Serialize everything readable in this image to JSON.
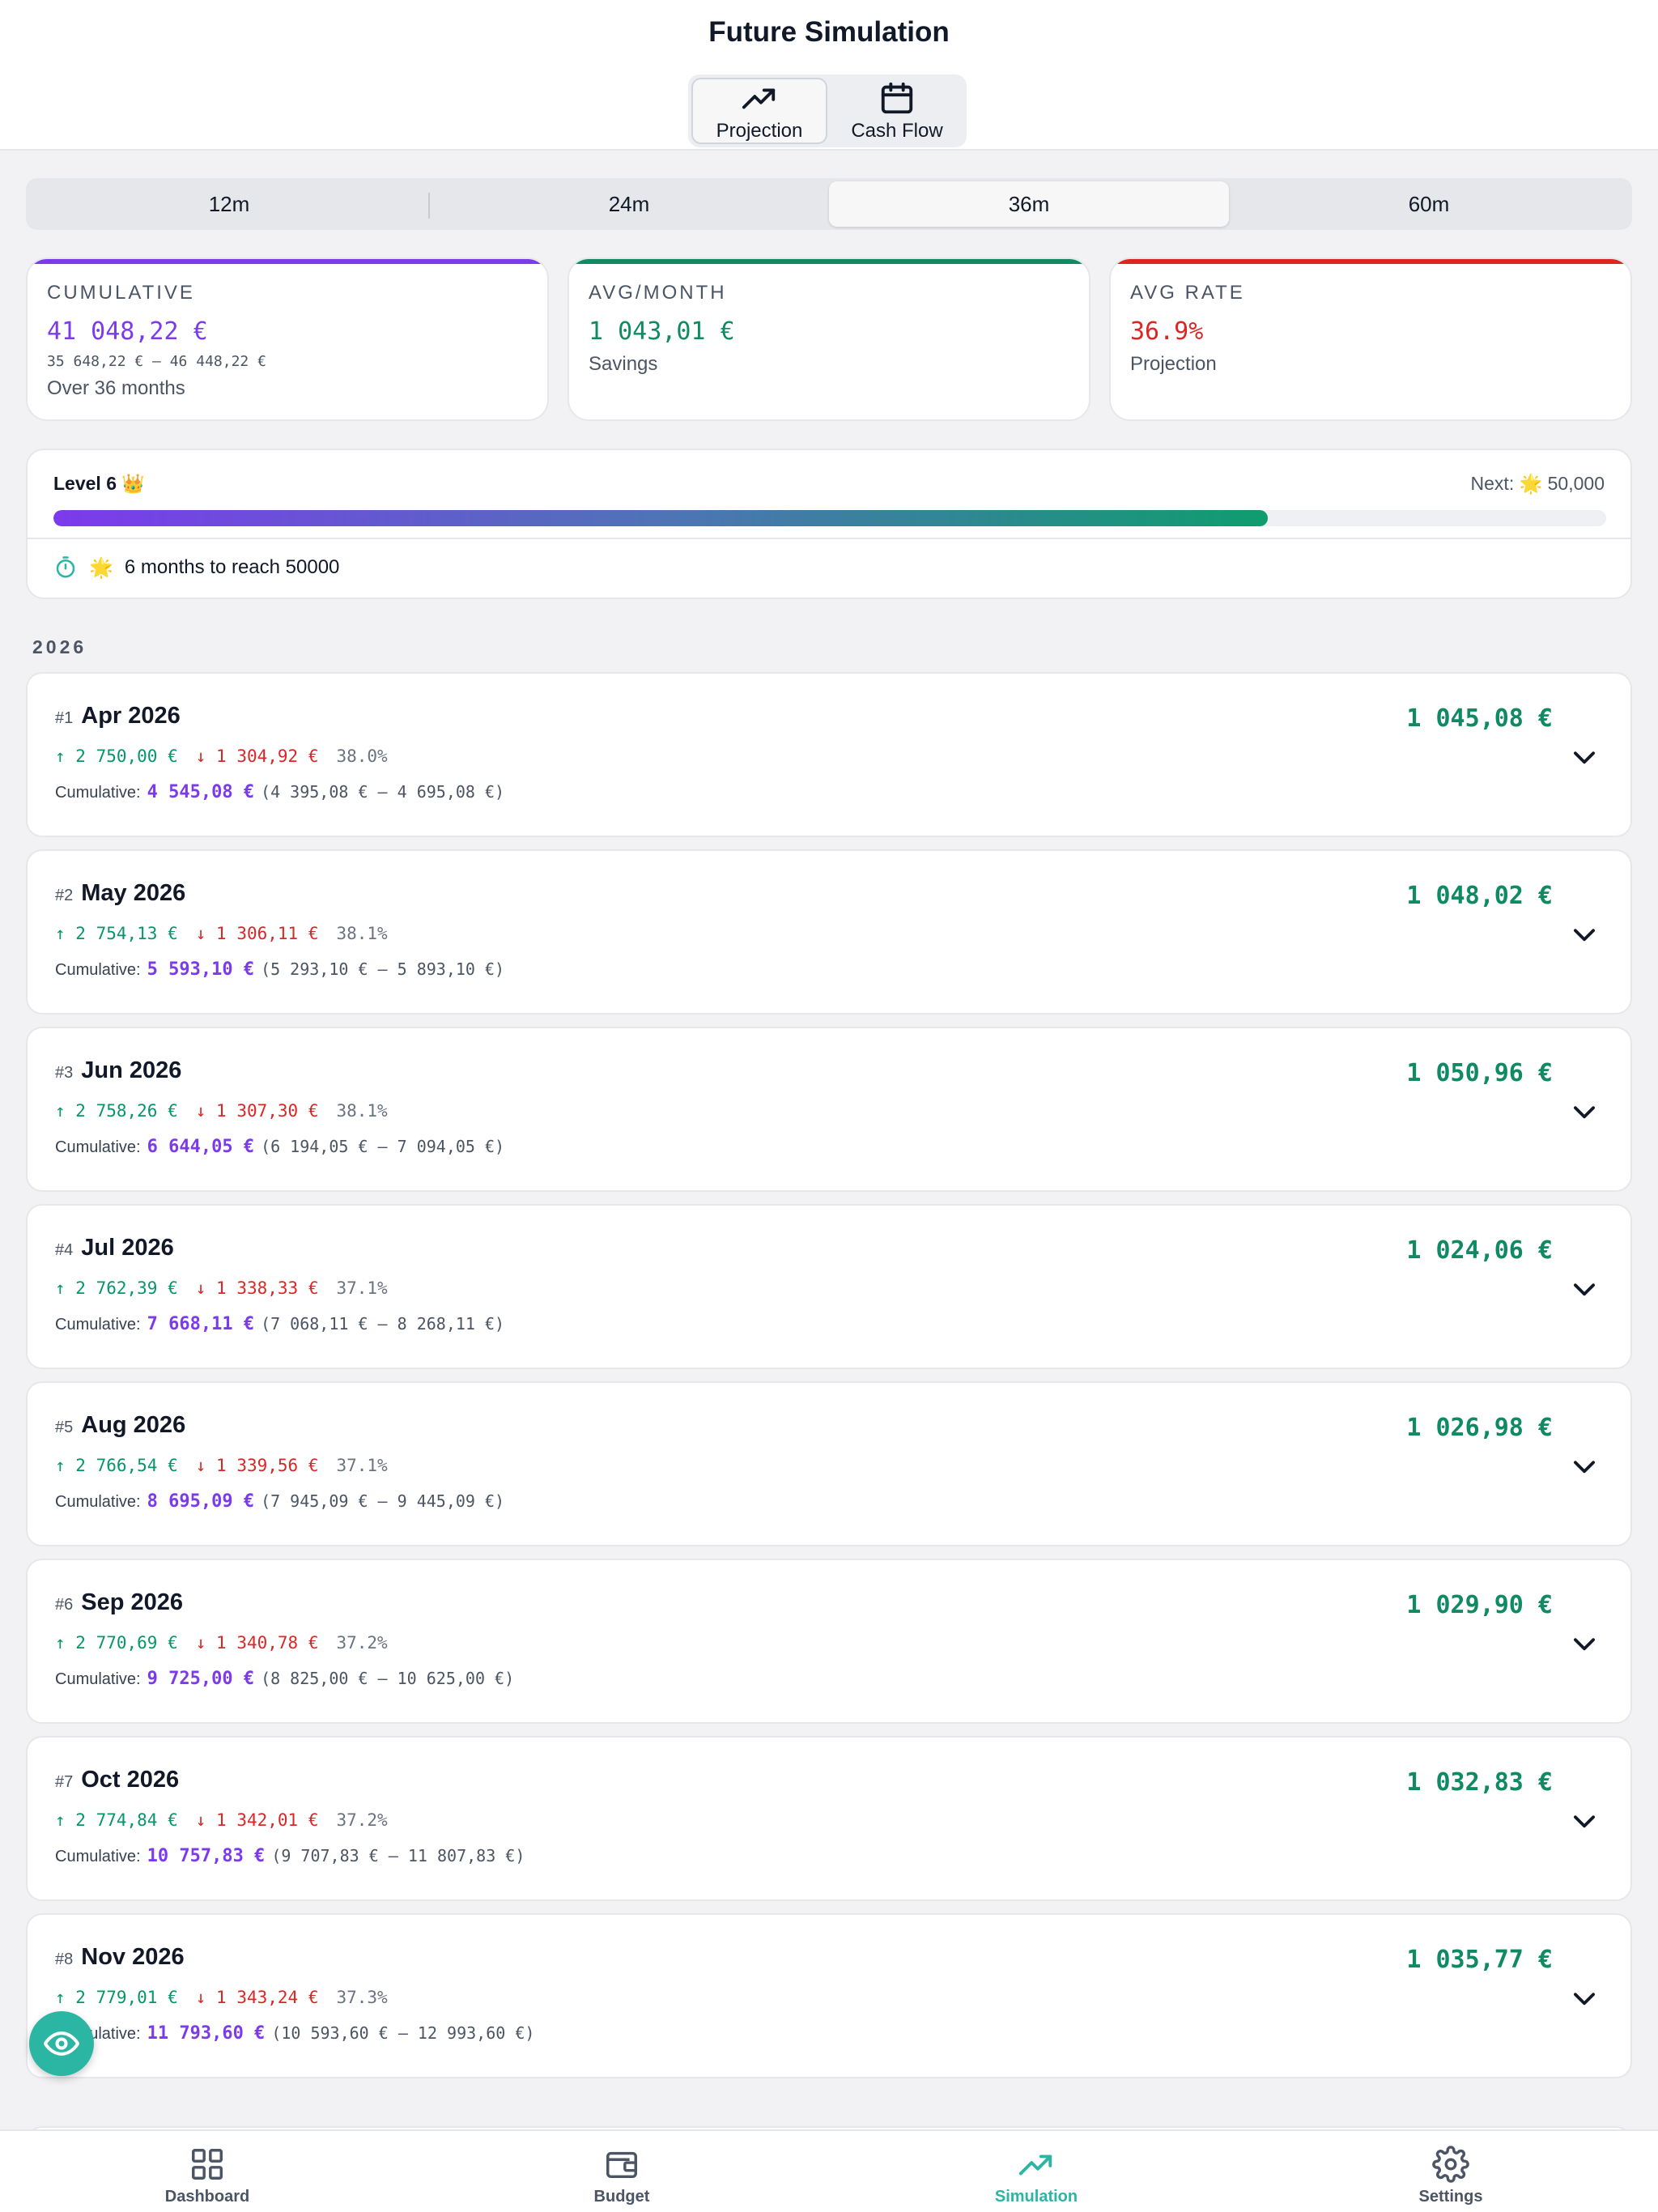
{
  "header": {
    "title": "Future Simulation",
    "modes": [
      {
        "label": "Projection",
        "icon": "trending-up-icon",
        "active": true
      },
      {
        "label": "Cash Flow",
        "icon": "calendar-icon",
        "active": false
      }
    ]
  },
  "periods": [
    {
      "label": "12m",
      "active": false
    },
    {
      "label": "24m",
      "active": false
    },
    {
      "label": "36m",
      "active": true
    },
    {
      "label": "60m",
      "active": false
    }
  ],
  "stats": {
    "cumulative": {
      "label": "CUMULATIVE",
      "value": "41 048,22 €",
      "range": "35 648,22 € – 46 448,22 €",
      "sub": "Over 36 months",
      "color": "#7c3aed"
    },
    "avg_month": {
      "label": "AVG/MONTH",
      "value": "1 043,01 €",
      "sub": "Savings",
      "color": "#0f8a63"
    },
    "avg_rate": {
      "label": "AVG RATE",
      "value": "36.9%",
      "sub": "Projection",
      "color": "#dc2626"
    }
  },
  "level": {
    "title": "Level 6 👑",
    "next_label": "Next:",
    "next_icon": "🌟",
    "next_value": "50,000",
    "progress": 0.782,
    "eta_icon": "🌟",
    "eta_text": "6 months to reach 50000"
  },
  "year": "2026",
  "months": [
    {
      "index": "#1",
      "name": "Apr 2026",
      "income": "2 750,00 €",
      "expense": "1 304,92 €",
      "rate": "38.0%",
      "cum_label": "Cumulative:",
      "cum": "4 545,08 €",
      "cum_range": "(4 395,08 € – 4 695,08 €)",
      "net": "1 045,08 €"
    },
    {
      "index": "#2",
      "name": "May 2026",
      "income": "2 754,13 €",
      "expense": "1 306,11 €",
      "rate": "38.1%",
      "cum_label": "Cumulative:",
      "cum": "5 593,10 €",
      "cum_range": "(5 293,10 € – 5 893,10 €)",
      "net": "1 048,02 €"
    },
    {
      "index": "#3",
      "name": "Jun 2026",
      "income": "2 758,26 €",
      "expense": "1 307,30 €",
      "rate": "38.1%",
      "cum_label": "Cumulative:",
      "cum": "6 644,05 €",
      "cum_range": "(6 194,05 € – 7 094,05 €)",
      "net": "1 050,96 €"
    },
    {
      "index": "#4",
      "name": "Jul 2026",
      "income": "2 762,39 €",
      "expense": "1 338,33 €",
      "rate": "37.1%",
      "cum_label": "Cumulative:",
      "cum": "7 668,11 €",
      "cum_range": "(7 068,11 € – 8 268,11 €)",
      "net": "1 024,06 €"
    },
    {
      "index": "#5",
      "name": "Aug 2026",
      "income": "2 766,54 €",
      "expense": "1 339,56 €",
      "rate": "37.1%",
      "cum_label": "Cumulative:",
      "cum": "8 695,09 €",
      "cum_range": "(7 945,09 € – 9 445,09 €)",
      "net": "1 026,98 €"
    },
    {
      "index": "#6",
      "name": "Sep 2026",
      "income": "2 770,69 €",
      "expense": "1 340,78 €",
      "rate": "37.2%",
      "cum_label": "Cumulative:",
      "cum": "9 725,00 €",
      "cum_range": "(8 825,00 € – 10 625,00 €)",
      "net": "1 029,90 €"
    },
    {
      "index": "#7",
      "name": "Oct 2026",
      "income": "2 774,84 €",
      "expense": "1 342,01 €",
      "rate": "37.2%",
      "cum_label": "Cumulative:",
      "cum": "10 757,83 €",
      "cum_range": "(9 707,83 € – 11 807,83 €)",
      "net": "1 032,83 €"
    },
    {
      "index": "#8",
      "name": "Nov 2026",
      "income": "2 779,01 €",
      "expense": "1 343,24 €",
      "rate": "37.3%",
      "cum_label": "Cumulative:",
      "cum": "11 793,60 €",
      "cum_range": "(10 593,60 € – 12 993,60 €)",
      "net": "1 035,77 €"
    }
  ],
  "tabs": [
    {
      "label": "Dashboard",
      "icon": "grid-icon",
      "active": false
    },
    {
      "label": "Budget",
      "icon": "wallet-icon",
      "active": false
    },
    {
      "label": "Simulation",
      "icon": "trending-up-icon",
      "active": true
    },
    {
      "label": "Settings",
      "icon": "gear-icon",
      "active": false
    }
  ],
  "colors": {
    "accent": "#2bb5a3",
    "income": "#059669",
    "expense": "#dc2626",
    "cumulative": "#7c3aed",
    "net": "#0f8a63"
  }
}
